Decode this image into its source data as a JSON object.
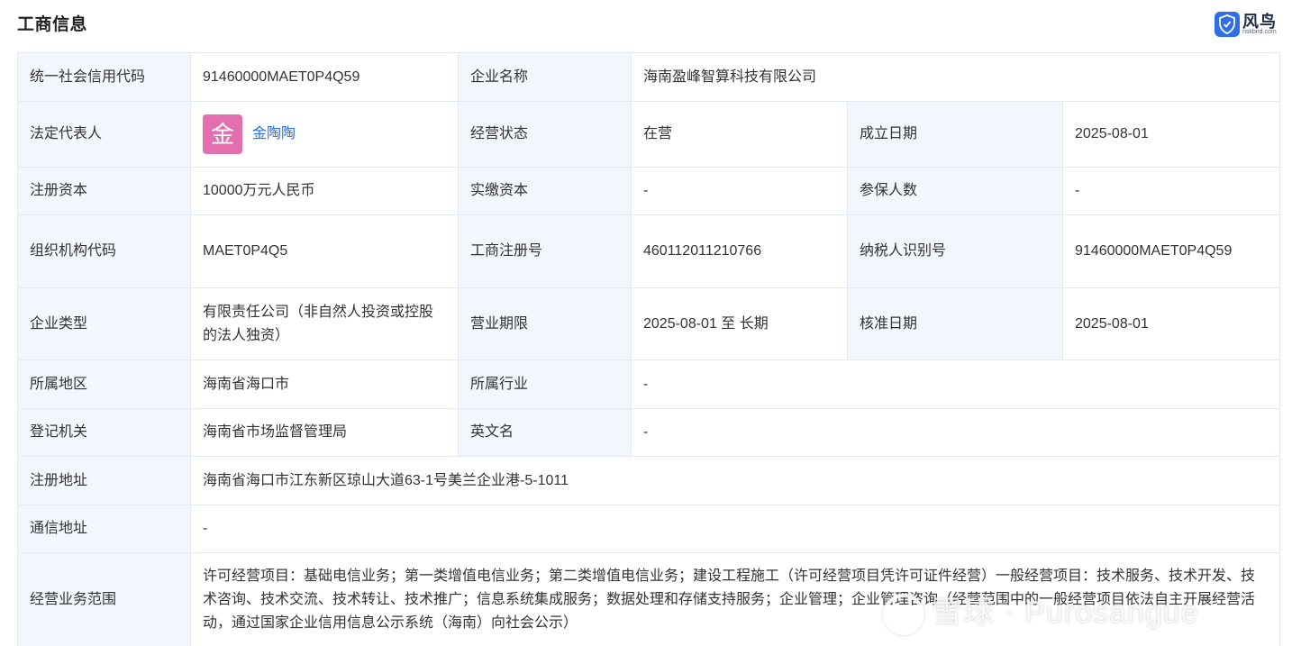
{
  "header": {
    "title": "工商信息",
    "brand": {
      "name": "风鸟",
      "url_text": "riskbird.com",
      "icon": "shield-icon",
      "color": "#2f6ee6"
    }
  },
  "fields": {
    "uscc": {
      "label": "统一社会信用代码",
      "value": "91460000MAET0P4Q59"
    },
    "company_name": {
      "label": "企业名称",
      "value": "海南盈峰智算科技有限公司"
    },
    "legal_rep": {
      "label": "法定代表人",
      "avatar_char": "金",
      "name": "金陶陶",
      "avatar_color": "#e46fae"
    },
    "status": {
      "label": "经营状态",
      "value": "在营"
    },
    "established": {
      "label": "成立日期",
      "value": "2025-08-01"
    },
    "registered_capital": {
      "label": "注册资本",
      "value": "10000万元人民币"
    },
    "paid_capital": {
      "label": "实缴资本",
      "value": "-"
    },
    "insured": {
      "label": "参保人数",
      "value": "-"
    },
    "org_code": {
      "label": "组织机构代码",
      "value": "MAET0P4Q5"
    },
    "reg_number": {
      "label": "工商注册号",
      "value": "460112011210766"
    },
    "taxpayer_id": {
      "label": "纳税人识别号",
      "value": "91460000MAET0P4Q59"
    },
    "company_type": {
      "label": "企业类型",
      "value": "有限责任公司（非自然人投资或控股的法人独资）"
    },
    "business_term": {
      "label": "营业期限",
      "value": "2025-08-01 至 长期"
    },
    "approval_date": {
      "label": "核准日期",
      "value": "2025-08-01"
    },
    "region": {
      "label": "所属地区",
      "value": "海南省海口市"
    },
    "industry": {
      "label": "所属行业",
      "value": "-"
    },
    "authority": {
      "label": "登记机关",
      "value": "海南省市场监督管理局"
    },
    "english_name": {
      "label": "英文名",
      "value": "-"
    },
    "reg_address": {
      "label": "注册地址",
      "value": "海南省海口市江东新区琼山大道63-1号美兰企业港-5-1011"
    },
    "contact_address": {
      "label": "通信地址",
      "value": "-"
    },
    "business_scope": {
      "label": "经营业务范围",
      "value": "许可经营项目：基础电信业务；第一类增值电信业务；第二类增值电信业务；建设工程施工（许可经营项目凭许可证件经营）一般经营项目：技术服务、技术开发、技术咨询、技术交流、技术转让、技术推广；信息系统集成服务；数据处理和存储支持服务；企业管理；企业管理咨询（经营范围中的一般经营项目依法自主开展经营活动，通过国家企业信用信息公示系统（海南）向社会公示）"
    }
  },
  "watermark": {
    "text": "雪球 · Purosangue"
  }
}
